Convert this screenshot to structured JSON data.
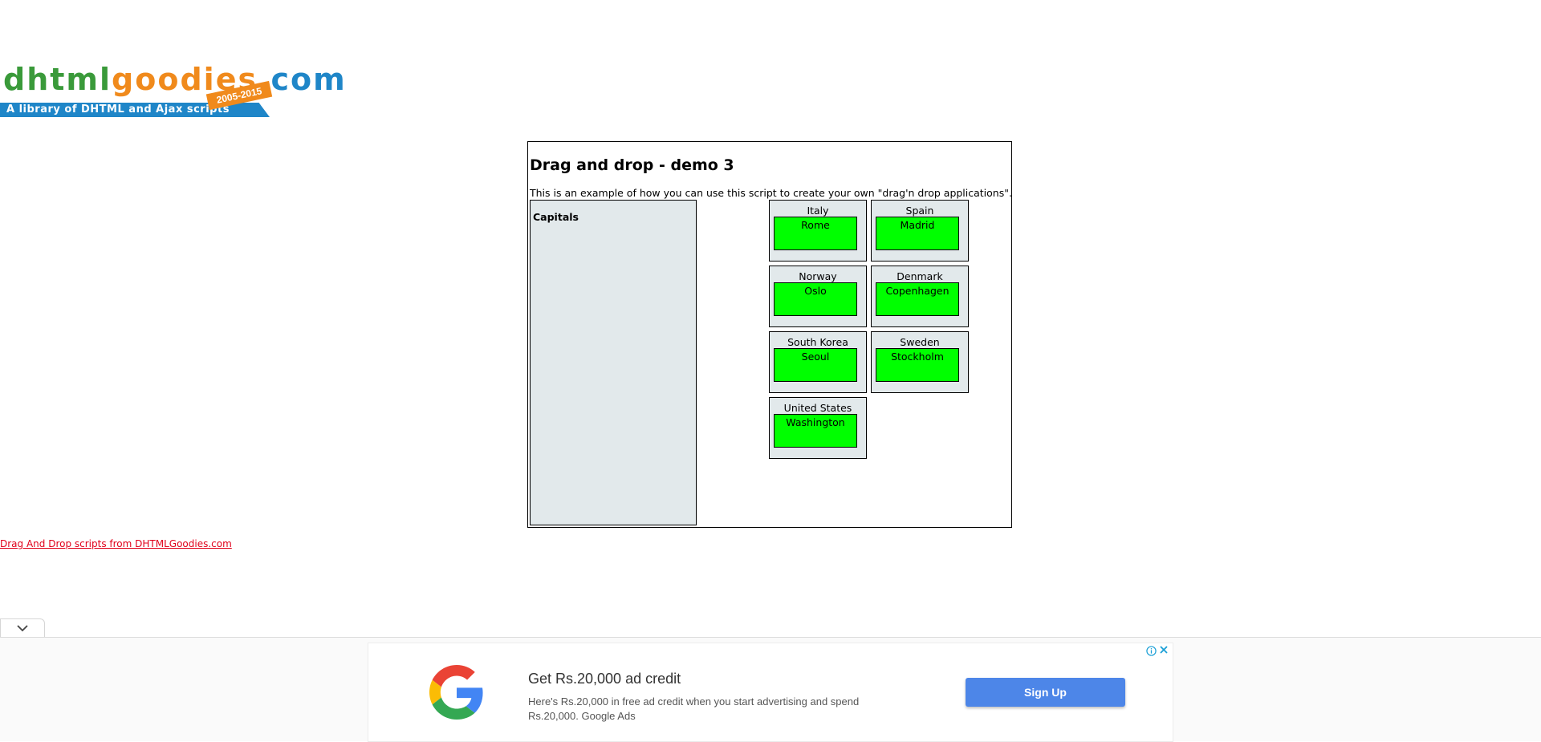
{
  "logo": {
    "part1": "dhtml",
    "part2": "goodies",
    "part3": ".com",
    "tagline": "A library of DHTML and Ajax scripts",
    "years": "2005-2015"
  },
  "demo": {
    "title": "Drag and drop - demo 3",
    "intro": "This is an example of how you can use this script to create your own \"drag'n drop applications\".",
    "capitals_label": "Capitals",
    "countries": [
      {
        "country": "Italy",
        "capital": "Rome"
      },
      {
        "country": "Spain",
        "capital": "Madrid"
      },
      {
        "country": "Norway",
        "capital": "Oslo"
      },
      {
        "country": "Denmark",
        "capital": "Copenhagen"
      },
      {
        "country": "South Korea",
        "capital": "Seoul"
      },
      {
        "country": "Sweden",
        "capital": "Stockholm"
      },
      {
        "country": "United States",
        "capital": "Washington"
      }
    ]
  },
  "footer": {
    "link_text": "Drag And Drop scripts from DHTMLGoodies.com"
  },
  "ad": {
    "headline": "Get Rs.20,000 ad credit",
    "description": "Here's Rs.20,000 in free ad credit when you start advertising and spend Rs.20,000. Google Ads",
    "button_label": "Sign Up",
    "button_color": "#4d86e8"
  },
  "colors": {
    "capital_chip": "#00ff00",
    "drop_zone": "#e2e9eb",
    "link": "#e0001a"
  }
}
